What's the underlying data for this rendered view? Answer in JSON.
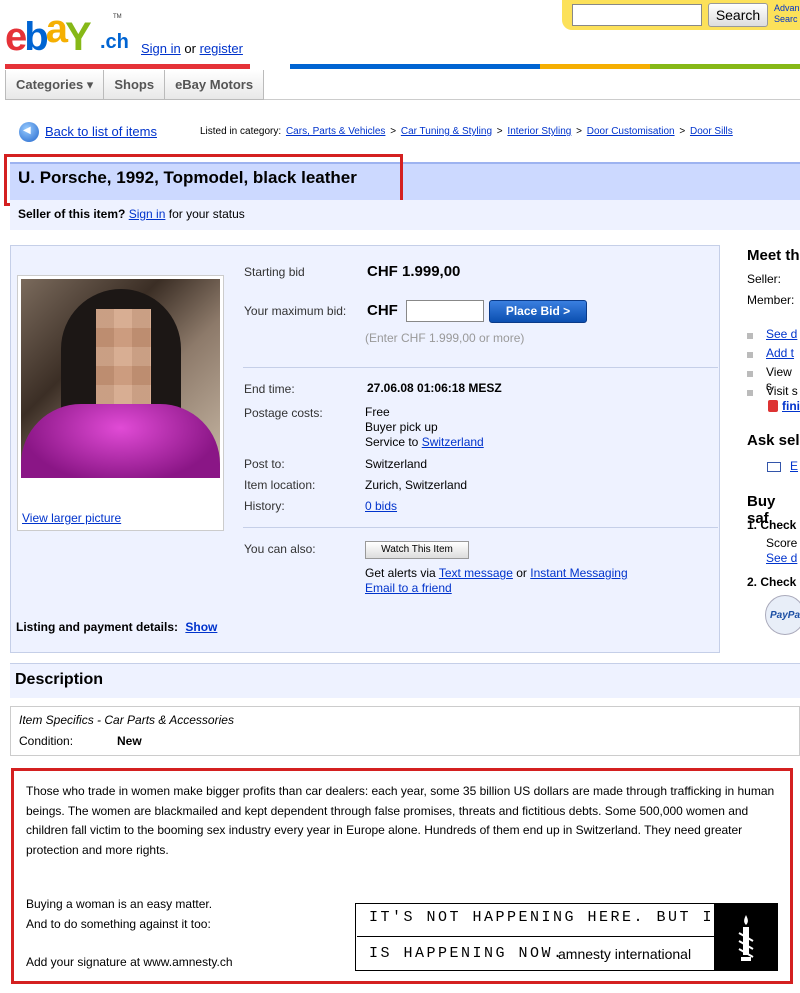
{
  "header": {
    "logo_text": "ebaY.ch",
    "sign_in": "Sign in",
    "or": "or",
    "register": "register",
    "search_button": "Search",
    "advanced": "Advan Searc",
    "brand_colors": [
      "#e53238",
      "#0064d2",
      "#f5af02",
      "#86b817"
    ]
  },
  "nav": {
    "tabs": [
      "Categories ▾",
      "Shops",
      "eBay Motors"
    ]
  },
  "breadcrumb": {
    "back": "Back to list of items",
    "listed_in": "Listed in category:",
    "items": [
      "Cars, Parts & Vehicles",
      "Car Tuning & Styling",
      "Interior Styling",
      "Door Customisation",
      "Door Sills"
    ],
    "separator": ">"
  },
  "item": {
    "title": "U. Porsche, 1992, Topmodel, black leather",
    "seller_question": "Seller of this item?",
    "seller_signin": "Sign in",
    "seller_status": "for your status",
    "view_larger": "View larger picture",
    "starting_bid_label": "Starting bid",
    "starting_bid": "CHF 1.999,00",
    "max_bid_label": "Your maximum bid:",
    "currency": "CHF",
    "place_bid": "Place Bid >",
    "bid_hint": "(Enter CHF 1.999,00 or more)",
    "end_time_label": "End time:",
    "end_time": "27.06.08 01:06:18 MESZ",
    "postage_label": "Postage costs:",
    "postage_free": "Free",
    "postage_pickup": "Buyer pick up",
    "postage_service": "Service to",
    "postage_country": "Switzerland",
    "post_to_label": "Post to:",
    "post_to": "Switzerland",
    "location_label": "Item location:",
    "location": "Zurich, Switzerland",
    "history_label": "History:",
    "history": "0 bids",
    "also_label": "You can also:",
    "watch": "Watch This Item",
    "alerts_prefix": "Get alerts via",
    "alerts_text": "Text message",
    "alerts_or": "or",
    "alerts_im": "Instant Messaging",
    "email_friend": "Email to a friend",
    "listing_details": "Listing and payment details:",
    "show": "Show"
  },
  "sidebar": {
    "meet": "Meet th",
    "seller": "Seller:",
    "member": "Member:",
    "links": [
      "See d",
      "Add t",
      "View s",
      "Visit s"
    ],
    "fin": "fini",
    "ask": "Ask sel",
    "email": "E",
    "buy_safe": "Buy saf",
    "check1": "1.  Check",
    "score": "Score",
    "see_d": "See d",
    "check2": "2.  Check",
    "paypal": "PayPa"
  },
  "description": {
    "heading": "Description",
    "specifics": "Item Specifics - Car Parts & Accessories",
    "condition_label": "Condition:",
    "condition": "New"
  },
  "amnesty": {
    "paragraph": "Those who trade in women make bigger profits than car dealers: each year, some 35 billion US dollars are made through trafficking in human beings. The women are blackmailed and kept dependent through false promises, threats and fictitious debts. Some 500,000 women and children fall victim to the booming sex industry every year in Europe alone. Hundreds of them end up in Switzerland. They need greater protection and more rights.",
    "line1": "Buying a woman is an easy matter.",
    "line2": "And to do something against it too:",
    "line3": "Add your signature at www.amnesty.ch",
    "slogan1": "IT'S NOT HAPPENING HERE. BUT IT",
    "slogan2": "IS HAPPENING NOW.",
    "org": "amnesty international",
    "highlight_color": "#d42020"
  }
}
